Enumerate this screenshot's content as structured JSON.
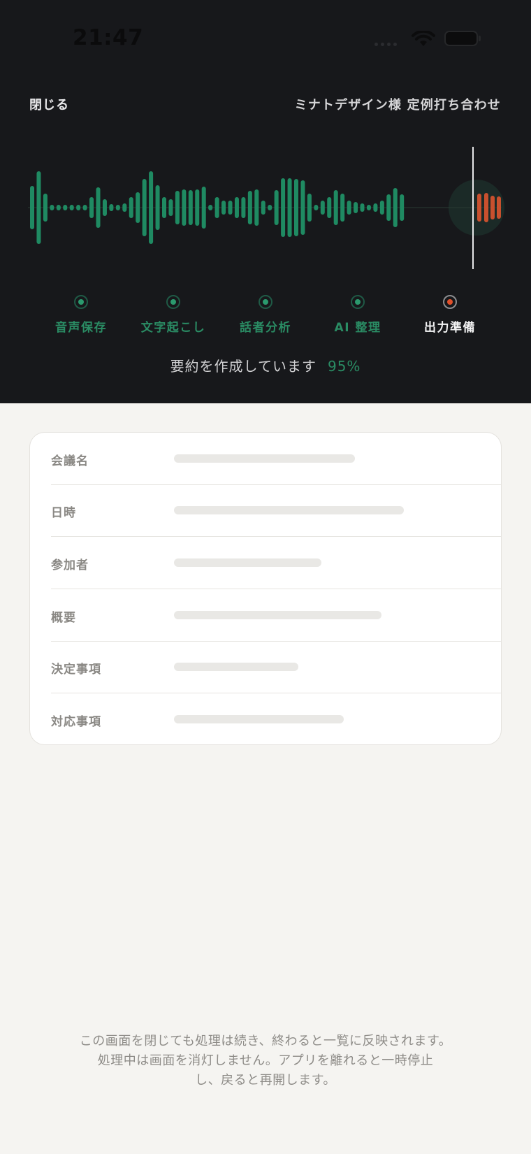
{
  "status_bar": {
    "time": "21:47",
    "wifi_icon": "wifi-icon",
    "battery_icon": "battery-icon"
  },
  "header": {
    "close_label": "閉じる",
    "meeting_title": "ミナトデザイン様 定例打ち合わせ"
  },
  "colors": {
    "accent_green": "#2a8c64",
    "wave_green": "#1f8a62",
    "wave_orange": "#c8502e",
    "dark_bg": "#17181b",
    "light_bg": "#f5f4f1"
  },
  "steps": [
    {
      "label": "音声保存",
      "state": "done"
    },
    {
      "label": "文字起こし",
      "state": "done"
    },
    {
      "label": "話者分析",
      "state": "done"
    },
    {
      "label": "AI 整理",
      "state": "done"
    },
    {
      "label": "出力準備",
      "state": "active"
    }
  ],
  "progress": {
    "message": "要約を作成しています",
    "percent_text": "95%",
    "percent": 95
  },
  "summary_fields": [
    {
      "label": "会議名",
      "placeholder_fill": 0.48
    },
    {
      "label": "日時",
      "placeholder_fill": 0.61
    },
    {
      "label": "参加者",
      "placeholder_fill": 0.39
    },
    {
      "label": "概要",
      "placeholder_fill": 0.55
    },
    {
      "label": "決定事項",
      "placeholder_fill": 0.33
    },
    {
      "label": "対応事項",
      "placeholder_fill": 0.45
    }
  ],
  "footer_note": {
    "line1": "この画面を閉じても処理は続き、終わると一覧に反映されます。",
    "line2": "処理中は画面を消灯しません。アプリを離れると一時停止",
    "line3": "し、戻ると再開します。"
  }
}
